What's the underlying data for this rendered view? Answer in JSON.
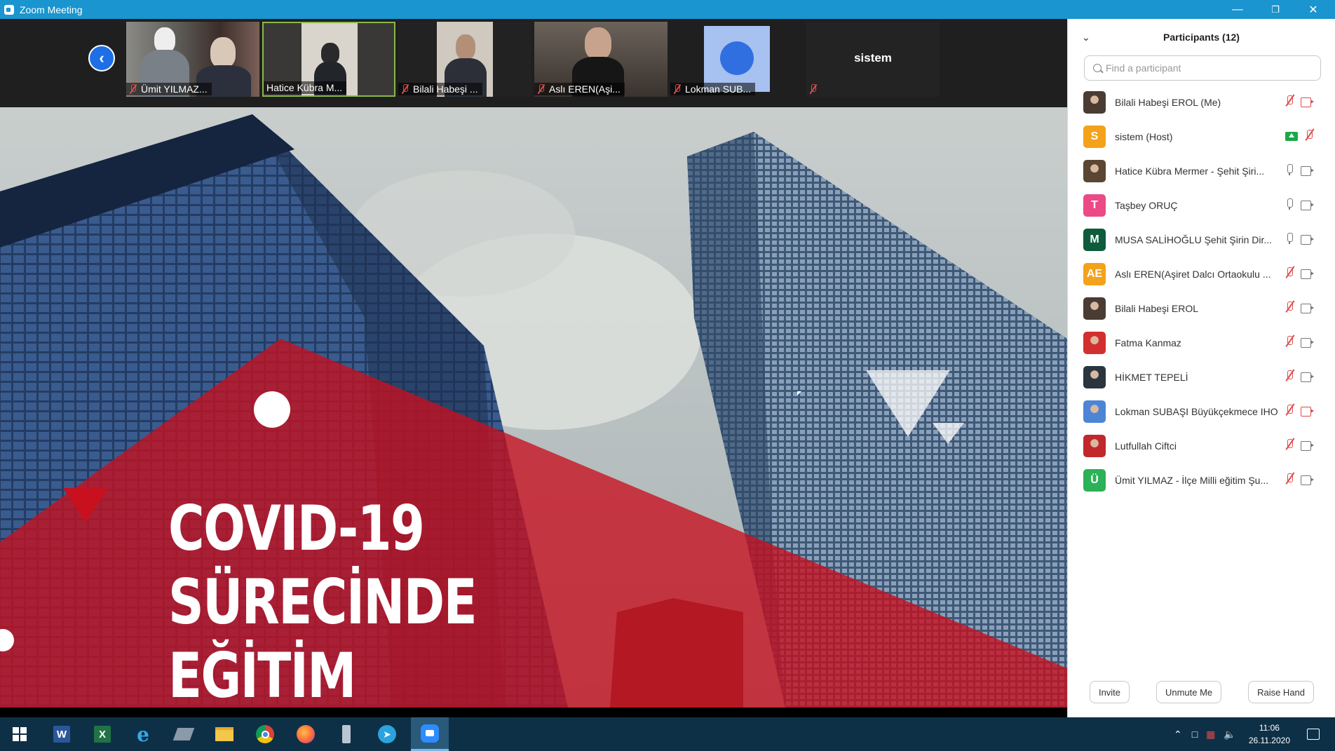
{
  "window": {
    "title": "Zoom Meeting",
    "controls": [
      "minimize",
      "restore",
      "close"
    ]
  },
  "gallery": {
    "tiles": [
      {
        "name": "Ümit YILMAZ...",
        "muted": true
      },
      {
        "name": "Hatice Kübra M...",
        "muted": false,
        "active_speaker": true
      },
      {
        "name": "Bilali Habeşi ...",
        "muted": true
      },
      {
        "name": "Aslı EREN(Aşi...",
        "muted": true
      },
      {
        "name": "Lokman SUB...",
        "muted": true
      },
      {
        "name": "",
        "label": "sistem",
        "muted": true
      }
    ]
  },
  "slide": {
    "line1": "COVID-19",
    "line2": "SÜRECİNDE",
    "line3": "EĞİTİM"
  },
  "participants": {
    "title": "Participants (12)",
    "search_placeholder": "Find a participant",
    "list": [
      {
        "name": "Bilali Habeşi EROL (Me)",
        "avatar": "photo",
        "color": "#4a3b33",
        "mic": "off",
        "cam": "off"
      },
      {
        "name": "sistem (Host)",
        "avatar": "S",
        "color": "#f4a21a",
        "mic": "off",
        "cam": "share"
      },
      {
        "name": "Hatice Kübra Mermer - Şehit Şiri...",
        "avatar": "photo",
        "color": "#5a4632",
        "mic": "on",
        "cam": "on"
      },
      {
        "name": "Taşbey ORUÇ",
        "avatar": "T",
        "color": "#ec4a86",
        "mic": "on",
        "cam": "on"
      },
      {
        "name": "MUSA SALİHOĞLU Şehit  Şirin Dir...",
        "avatar": "M",
        "color": "#0e5c3c",
        "mic": "on",
        "cam": "on"
      },
      {
        "name": "Aslı EREN(Aşiret Dalcı Ortaokulu ...",
        "avatar": "AE",
        "color": "#f4a21a",
        "mic": "off",
        "cam": "on"
      },
      {
        "name": "Bilali Habeşi EROL",
        "avatar": "photo",
        "color": "#4a3b33",
        "mic": "off",
        "cam": "on"
      },
      {
        "name": "Fatma Kanmaz",
        "avatar": "photo",
        "color": "#d23030",
        "mic": "off",
        "cam": "on"
      },
      {
        "name": "HİKMET TEPELİ",
        "avatar": "photo",
        "color": "#2b3540",
        "mic": "off",
        "cam": "on"
      },
      {
        "name": "Lokman SUBAŞI Büyükçekmece IHO",
        "avatar": "photo",
        "color": "#4d85d6",
        "mic": "off",
        "cam": "off"
      },
      {
        "name": "Lutfullah Ciftci",
        "avatar": "photo",
        "color": "#c0282c",
        "mic": "off",
        "cam": "on"
      },
      {
        "name": "Ümit YILMAZ - İlçe Milli eğitim Şu...",
        "avatar": "Ü",
        "color": "#2bb257",
        "mic": "off",
        "cam": "on"
      }
    ],
    "footer": {
      "invite": "Invite",
      "unmute": "Unmute Me",
      "raise_hand": "Raise Hand"
    }
  },
  "taskbar": {
    "apps": [
      "windows-start",
      "word",
      "excel",
      "internet-explorer",
      "unknown-app",
      "file-explorer",
      "chrome",
      "firefox",
      "usb-tool",
      "telegram",
      "zoom"
    ],
    "time": "11:06",
    "date": "26.11.2020"
  }
}
